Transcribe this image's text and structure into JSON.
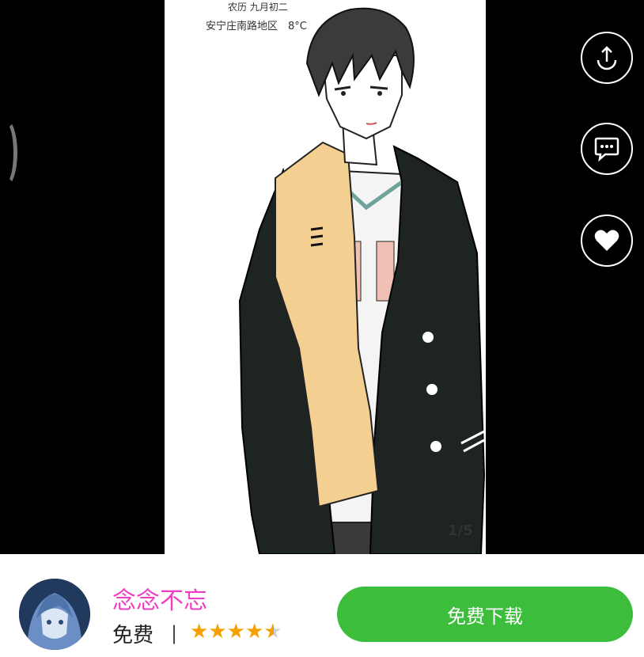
{
  "viewer": {
    "lunar_date": "农历 九月初二",
    "location": "安宁庄南路地区　8°C",
    "page_counter": "1/5"
  },
  "actions": {
    "share_icon": "share-icon",
    "comment_icon": "comment-icon",
    "like_icon": "heart-icon"
  },
  "app": {
    "name": "念念不忘",
    "price": "免费",
    "divider": "|",
    "rating": 4.5,
    "download_label": "免费下载"
  },
  "colors": {
    "app_name": "#ee3fc4",
    "download_button": "#3cbd3c",
    "star": "#f5a000"
  }
}
